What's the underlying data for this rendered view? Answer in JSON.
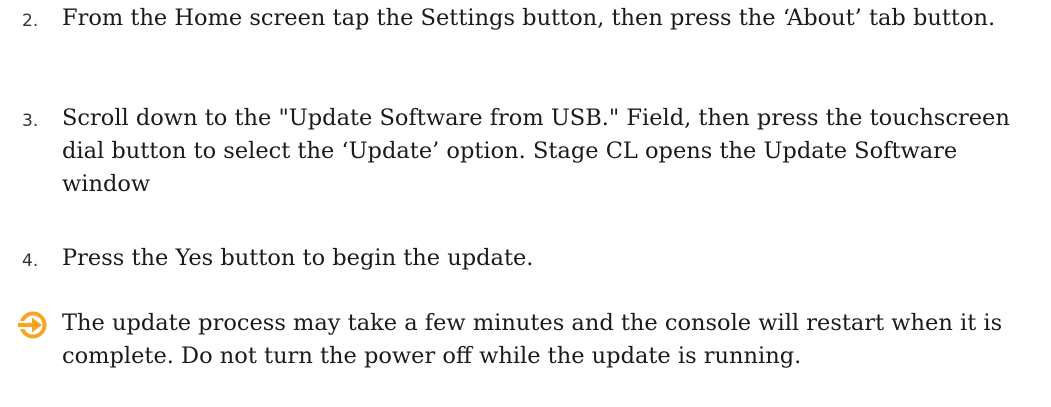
{
  "steps": [
    {
      "number": "2.",
      "text": "From the Home screen tap the Settings button, then press the ‘About’ tab button."
    },
    {
      "number": "3.",
      "text": "Scroll down to the \"Update Software from USB.\" Field, then press the touchscreen dial button to select the ‘Update’ option. Stage CL opens the Update Software window"
    },
    {
      "number": "4.",
      "text": "Press the Yes button to begin the update."
    }
  ],
  "note": {
    "icon": "arrow-circle-right-icon",
    "icon_color": "#F5A623",
    "text": "The update process may take a few minutes and the console will restart when it is complete. Do not turn the power off while the update is running."
  }
}
